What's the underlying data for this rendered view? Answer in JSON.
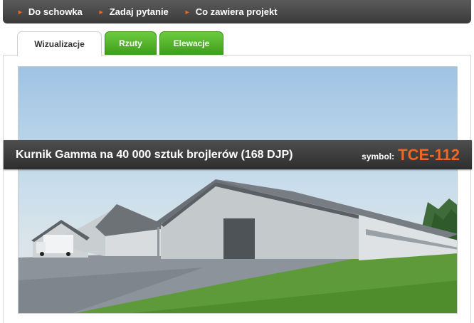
{
  "topnav": {
    "items": [
      {
        "label": "Do schowka"
      },
      {
        "label": "Zadaj pytanie"
      },
      {
        "label": "Co zawiera projekt"
      }
    ]
  },
  "tabs": [
    {
      "label": "Wizualizacje",
      "active": true
    },
    {
      "label": "Rzuty",
      "active": false
    },
    {
      "label": "Elewacje",
      "active": false
    }
  ],
  "project": {
    "title": "Kurnik Gamma na 40 000 sztuk brojlerów (168 DJP)",
    "symbol_label": "symbol:",
    "symbol_value": "TCE-112"
  },
  "colors": {
    "accent": "#f26522",
    "tab_green": "#4caf24",
    "bar_dark": "#3a3a3a"
  }
}
